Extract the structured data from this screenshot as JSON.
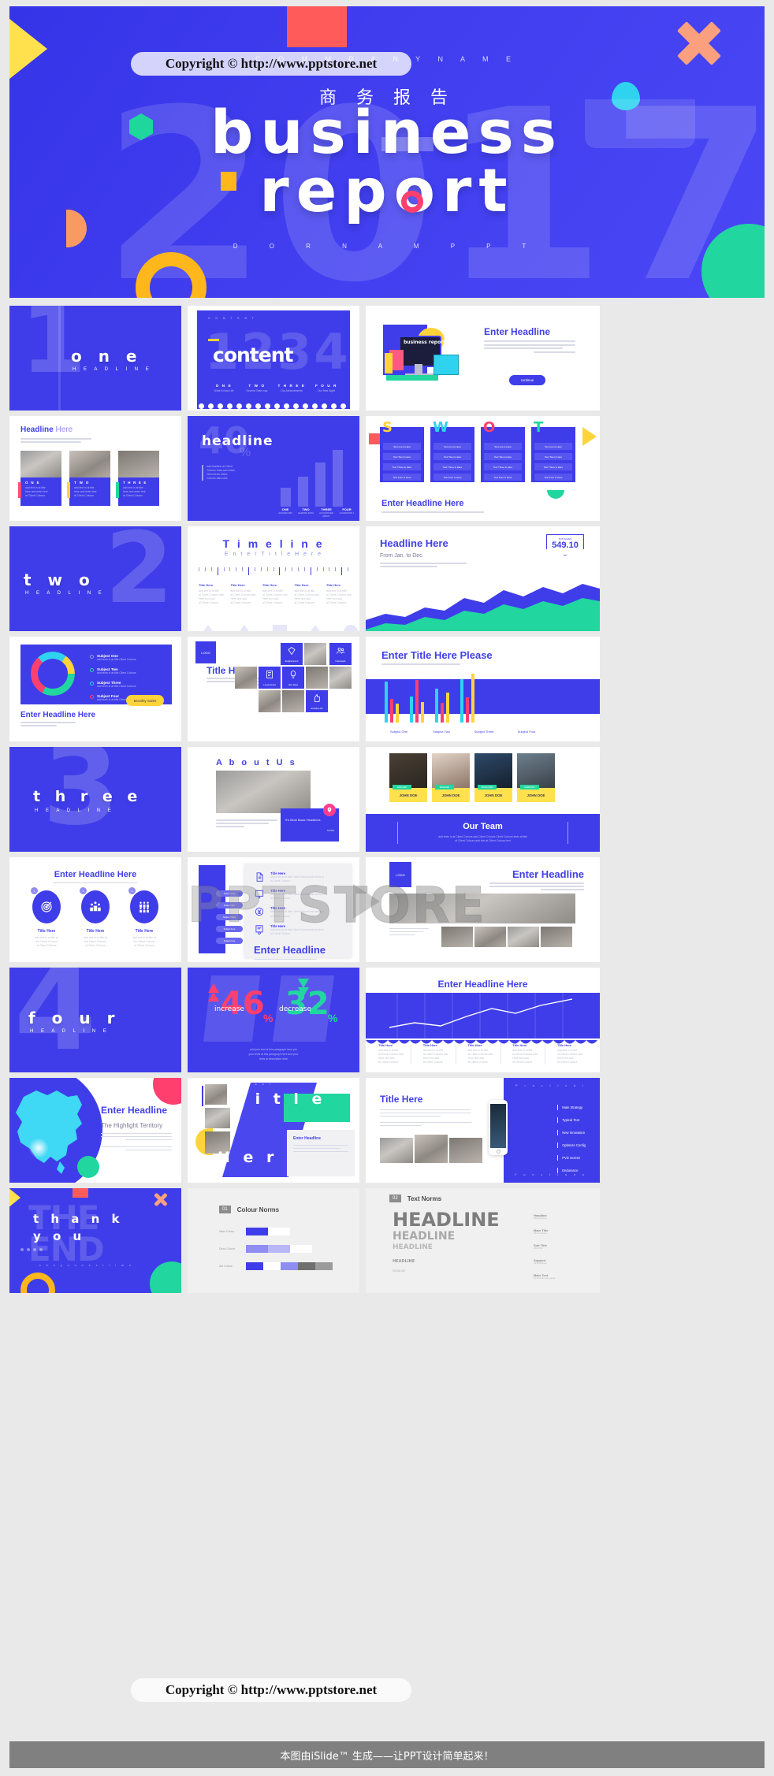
{
  "hero": {
    "company_label": "C O M M P A N Y   N A M E",
    "chinese_title": "商 务 报 告",
    "title_line1": "business",
    "title_line2": "report",
    "ghost_year": "2017",
    "brand_label": "D O R N A M   P P T"
  },
  "watermarks": {
    "top": "Copyright © http://www.pptstore.net",
    "bottom": "Copyright © http://www.pptstore.net",
    "center_brand": "PPTSTORE"
  },
  "footer": {
    "text": "本图由iSlide™ 生成——让PPT设计简单起来！"
  },
  "slides": {
    "s1": {
      "word": "o n e",
      "sub": "H E A D L I N E",
      "number": "1"
    },
    "s2": {
      "kicker": "C O N T E N T",
      "ghost": "1234",
      "title": "content",
      "items": [
        {
          "label": "O N E",
          "desc": "What A East Life"
        },
        {
          "label": "T W O",
          "desc": "Several Tears say"
        },
        {
          "label": "T H R E E",
          "desc": "Our Achievements"
        },
        {
          "label": "F O U R",
          "desc": "Our Best Sight"
        }
      ]
    },
    "s3": {
      "title": "Enter Headline",
      "button": "continue",
      "device_text": "business report"
    },
    "s4": {
      "title_a": "Headline",
      "title_b": "Here",
      "cards": [
        {
          "label": "O N E"
        },
        {
          "label": "T W O"
        },
        {
          "label": "T H R E E"
        }
      ]
    },
    "s5": {
      "ghost_value": "40",
      "ghost_unit": "%",
      "title": "headline",
      "bars": [
        {
          "label": "ONE",
          "sub": "ACCESS MIN",
          "value": 18
        },
        {
          "label": "TWO",
          "sub": "LEADING DATA",
          "value": 35
        },
        {
          "label": "THREE",
          "sub": "ACCOUNTED ABOUT",
          "value": 58
        },
        {
          "label": "FOUR",
          "sub": "ACCESSION 1",
          "value": 78
        }
      ]
    },
    "s6": {
      "letters": [
        "S",
        "W",
        "O",
        "T"
      ],
      "rows": [
        "Text one is Here",
        "Text Two is Here",
        "Text Three is Here",
        "Text Four is Here"
      ],
      "headline": "Enter  Headline  Here"
    },
    "s7": {
      "word": "t w o",
      "sub": "H E A D L I N E",
      "number": "2"
    },
    "s8": {
      "title": "T i m e l i n e",
      "subtitle": "E n t e r   T i t l e   H e r e",
      "columns": [
        "Title Here",
        "Title Here",
        "Title Here",
        "Title Here",
        "Title Here"
      ]
    },
    "s9": {
      "title": "Headline Here",
      "subtitle": "From Jan. to Dec.",
      "badge_label": "TOP SALES",
      "badge_value": "549.10"
    },
    "s10": {
      "headline": "Enter Headline Here",
      "button": "Monthly Sales",
      "legend": [
        "Subject One",
        "Subject Two",
        "Subject Three",
        "Subject Four"
      ]
    },
    "s11": {
      "logo": "LOGO",
      "title": "Title Here",
      "tiles": [
        "Enlightenment",
        "Lovely Guard",
        "New Ideas",
        "Framework",
        "Excellent Aid"
      ]
    },
    "s12": {
      "title": "Enter Title Here Please",
      "categories": [
        "Subject One",
        "Subject Two",
        "Subject Three",
        "Subject Four"
      ]
    },
    "s13": {
      "word": "t h r e e",
      "sub": "H E A D L I N E",
      "number": "3"
    },
    "s14": {
      "title": "A b o u t   U s",
      "card_title": "It's Most Basic Headlines",
      "card_button": "MORE"
    },
    "s15": {
      "team_title": "Our Team",
      "members": [
        {
          "role": "MANAGER",
          "name": "JOHN DOE"
        },
        {
          "role": "DESIGNER",
          "name": "JOHN DOE"
        },
        {
          "role": "DEVELOPER",
          "name": "JOHN DOE"
        },
        {
          "role": "MARKETER",
          "name": "JOHN DOE"
        }
      ]
    },
    "s16": {
      "title": "Enter Headline Here",
      "items": [
        {
          "num": "1",
          "icon": "target-icon",
          "title": "Title Here"
        },
        {
          "num": "2",
          "icon": "podium-icon",
          "title": "Title Here"
        },
        {
          "num": "3",
          "icon": "people-grid-icon",
          "title": "Title Here"
        }
      ]
    },
    "s17": {
      "headline": "Enter  Headline",
      "items": [
        {
          "icon": "document-icon",
          "title": "Title Here"
        },
        {
          "icon": "monitor-icon",
          "title": "Title Here"
        },
        {
          "icon": "yen-icon",
          "title": "Title Here"
        },
        {
          "icon": "certificate-icon",
          "title": "Title Here"
        }
      ],
      "pills": [
        "Subject One",
        "Subject Two",
        "Subject Three",
        "Subject Four",
        "Subject Five"
      ]
    },
    "s18": {
      "logo": "LOGO",
      "title": "Enter Headline"
    },
    "s19": {
      "word": "f o u r",
      "sub": "H E A D L I N E",
      "number": "4"
    },
    "s20": {
      "increase_value": "46",
      "increase_unit": "%",
      "increase_label": "increase",
      "decrease_value": "32",
      "decrease_unit": "%",
      "decrease_label": "decrease",
      "caption": "add your text at this paragraph here you\nyour texts at this paragraph here and your\ntexts at description here"
    },
    "s21": {
      "title": "Enter Headline Here",
      "points": [
        14,
        18,
        17,
        23,
        29,
        27,
        31,
        38
      ],
      "columns": [
        "Title Here",
        "Title Here",
        "Title Here",
        "Title Here",
        "Title Here"
      ]
    },
    "s22": {
      "title": "Enter Headline",
      "subtitle": "The Highlight Territory"
    },
    "s23": {
      "kicker": "C O N T E N T",
      "title_a": "T i t l e",
      "title_b": "H e r e",
      "card_title": "Enter Headline"
    },
    "s24": {
      "title": "Title Here",
      "side_top": "P r a c t i c a l",
      "side_bottom": "F u n c t i o n s",
      "list": [
        "Main Strategy",
        "Typical Text",
        "New Innovation",
        "Optimize Config",
        "PVD Screen",
        "Endurance"
      ]
    },
    "s25": {
      "line1": "t h a n k",
      "line2": "y o u",
      "ghost": "THE END",
      "sub": "s e e   y o u   n e x t   t i m e"
    },
    "s26": {
      "badge": "01",
      "title": "Colour Norms",
      "rows": [
        {
          "label": "Main Colour",
          "swatches": [
            "#3f3de9",
            "#ffffff"
          ]
        },
        {
          "label": "Deco Colour",
          "swatches": [
            "#8f8df2",
            "#b8b6f7",
            "#ffffff"
          ]
        },
        {
          "label": "Aid Colour",
          "swatches": [
            "#3f3de9",
            "#ffffff",
            "#8f8df2",
            "#6f6f6f",
            "#9b9b9b"
          ]
        }
      ]
    },
    "s27": {
      "badge": "02",
      "title": "Text Norms",
      "samples": [
        {
          "text": "HEADLINE",
          "name": "Headline",
          "meta": "40-60 element"
        },
        {
          "text": "HEADLINE",
          "name": "Main Title",
          "meta": "28-32 element"
        },
        {
          "text": "HEADLINE",
          "name": "Sub Title",
          "meta": "18-22 N/A"
        },
        {
          "text": "HEADLINE",
          "name": "Support",
          "meta": "14-16 element"
        },
        {
          "text": "HEADLINE",
          "name": "Main Text",
          "meta": "10-12 small, grey, greek"
        }
      ]
    }
  },
  "colors": {
    "brand_blue": "#3f3de9",
    "accent_pink": "#ff3f6e",
    "accent_green": "#22d6a0",
    "accent_yellow": "#ffd43b",
    "accent_cyan": "#2fd3ef",
    "accent_orange": "#f99a63"
  }
}
